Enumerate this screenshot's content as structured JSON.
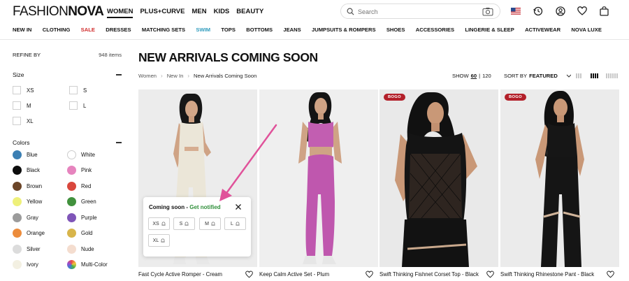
{
  "header": {
    "logo_part1": "FASHION",
    "logo_part2": "NOVA",
    "gender_nav": [
      "WOMEN",
      "PLUS+CURVE",
      "MEN",
      "KIDS",
      "BEAUTY"
    ],
    "search_placeholder": "Search",
    "icons": [
      "us-flag-icon",
      "history-icon",
      "account-icon",
      "wishlist-icon",
      "bag-icon"
    ]
  },
  "categories": [
    "NEW IN",
    "CLOTHING",
    "SALE",
    "DRESSES",
    "MATCHING SETS",
    "SWIM",
    "TOPS",
    "BOTTOMS",
    "JEANS",
    "JUMPSUITS & ROMPERS",
    "SHOES",
    "ACCESSORIES",
    "LINGERIE & SLEEP",
    "ACTIVEWEAR",
    "NOVA LUXE"
  ],
  "accent_colors": {
    "sale": "#d02a2a",
    "swim": "#2f9bbd",
    "bogo": "#b3202a",
    "notify": "#2f8f3a",
    "annotation_arrow": "#e0529a"
  },
  "sidebar": {
    "refine_label": "REFINE BY",
    "item_count": "948 items",
    "size_heading": "Size",
    "sizes": [
      "XS",
      "S",
      "M",
      "L",
      "XL"
    ],
    "colors_heading": "Colors",
    "colors": [
      {
        "name": "Blue",
        "hex": "#3b7fb3"
      },
      {
        "name": "White",
        "hex": "#ffffff"
      },
      {
        "name": "Black",
        "hex": "#0d0d0d"
      },
      {
        "name": "Pink",
        "hex": "#e684be"
      },
      {
        "name": "Brown",
        "hex": "#6b4528"
      },
      {
        "name": "Red",
        "hex": "#d9473d"
      },
      {
        "name": "Yellow",
        "hex": "#eef07a"
      },
      {
        "name": "Green",
        "hex": "#41913d"
      },
      {
        "name": "Gray",
        "hex": "#9b9b9b"
      },
      {
        "name": "Purple",
        "hex": "#7f55b8"
      },
      {
        "name": "Orange",
        "hex": "#ec8c3c"
      },
      {
        "name": "Gold",
        "hex": "#d8b54b"
      },
      {
        "name": "Silver",
        "hex": "#dcdcdc"
      },
      {
        "name": "Nude",
        "hex": "#f4ddcf"
      },
      {
        "name": "Ivory",
        "hex": "#f3f0e2"
      },
      {
        "name": "Multi-Color",
        "hex": "multi"
      }
    ]
  },
  "main": {
    "title": "NEW ARRIVALS COMING SOON",
    "breadcrumb": [
      "Women",
      "New In",
      "New Arrivals Coming Soon"
    ],
    "show_label": "SHOW",
    "show_options": [
      "60",
      "120"
    ],
    "show_separator": "|",
    "sort_label": "SORT BY",
    "sort_value": "FEATURED"
  },
  "products": [
    {
      "name": "Fast Cycle Active Romper - Cream",
      "badge": ""
    },
    {
      "name": "Keep Calm Active Set - Plum",
      "badge": ""
    },
    {
      "name": "Swift Thinking Fishnet Corset Top - Black",
      "badge": "BOGO"
    },
    {
      "name": "Swift Thinking Rhinestone Pant - Black",
      "badge": "BOGO"
    }
  ],
  "popup": {
    "title": "Coming soon - ",
    "link": "Get notified",
    "sizes": [
      "XS",
      "S",
      "M",
      "L",
      "XL"
    ]
  }
}
